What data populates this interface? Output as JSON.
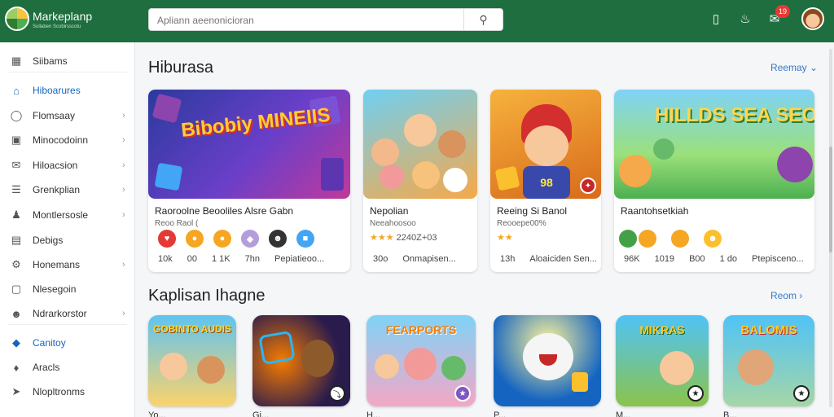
{
  "header": {
    "app_name": "Markeplanp",
    "app_sub": "Sullaben Scobirsscotu",
    "search_placeholder": "Apliann aeenonicioran",
    "notif_count": "19",
    "icons": [
      "phone-icon",
      "bell-icon",
      "chat-icon",
      "avatar"
    ]
  },
  "sidebar": {
    "items": [
      {
        "label": "Siibams",
        "icon": "grid-icon",
        "active": false,
        "chevron": false
      },
      {
        "label": "Hiboarures",
        "icon": "home-icon",
        "active": true,
        "chevron": false
      },
      {
        "label": "Flomsaay",
        "icon": "compass-icon",
        "active": false,
        "chevron": true
      },
      {
        "label": "Minocodoinn",
        "icon": "monitor-icon",
        "active": false,
        "chevron": true
      },
      {
        "label": "Hiloacsion",
        "icon": "chat-icon",
        "active": false,
        "chevron": true
      },
      {
        "label": "Grenkplian",
        "icon": "list-icon",
        "active": false,
        "chevron": true
      },
      {
        "label": "Montlersosle",
        "icon": "user-icon",
        "active": false,
        "chevron": true
      },
      {
        "label": "Debigs",
        "icon": "calendar-icon",
        "active": false,
        "chevron": false
      },
      {
        "label": "Honemans",
        "icon": "settings-icon",
        "active": false,
        "chevron": true
      },
      {
        "label": "Nlesegoin",
        "icon": "square-icon",
        "active": false,
        "chevron": false
      },
      {
        "label": "Ndrarkorstor",
        "icon": "profile-icon",
        "active": false,
        "chevron": true
      },
      {
        "label": "Canitoy",
        "icon": "shield-icon",
        "active": true,
        "chevron": false
      },
      {
        "label": "Aracls",
        "icon": "tag-icon",
        "active": false,
        "chevron": false
      },
      {
        "label": "Nlopltronms",
        "icon": "send-icon",
        "active": false,
        "chevron": false
      }
    ]
  },
  "section1": {
    "title": "Hiburasa",
    "more": "Reemay",
    "cards": [
      {
        "title": "Raoroolne Beooliles Alsre Gabn",
        "sub": "Reoo Raol (",
        "art": "Bibobiy MINEIIS",
        "stats": [
          "10k",
          "00",
          "1 1K",
          "7hn",
          "Pepiatieoo..."
        ]
      },
      {
        "title": "Nepolian",
        "sub": "Neeahoosoo",
        "rating": "2240Z+03",
        "stats": [
          "30o",
          "Onmapisen..."
        ]
      },
      {
        "title": "Reeing Si Banol",
        "sub": "Reooepe00%",
        "stats": [
          "13h",
          "Aloaiciden Sen..."
        ]
      },
      {
        "title": "Raantohsetkiah",
        "sub": "",
        "art": "HILLDS SEA SEORPEELK",
        "stats": [
          "96K",
          "1019",
          "B00",
          "1 do",
          "Ptepisceno..."
        ]
      }
    ]
  },
  "section2": {
    "title": "Kaplisan Ihagne",
    "more": "Reom",
    "tiles": [
      {
        "art": "GOBINTO AUDIS",
        "label": "Yo..."
      },
      {
        "art": "",
        "label": "Gi..."
      },
      {
        "art": "FEARPORTS",
        "label": "H..."
      },
      {
        "art": "",
        "label": "P..."
      },
      {
        "art": "MIKRAS",
        "label": "M..."
      },
      {
        "art": "BALOMIS",
        "label": "B..."
      }
    ]
  },
  "colors": {
    "topbar": "#1f6e3f",
    "accent": "#1565c0",
    "link": "#3b78c4"
  }
}
